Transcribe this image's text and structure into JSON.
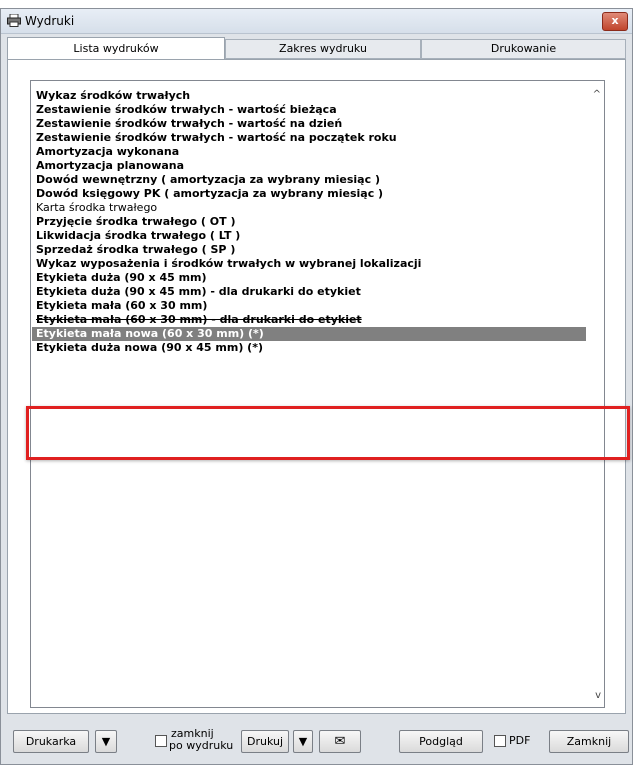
{
  "window": {
    "title": "Wydruki",
    "close_glyph": "x"
  },
  "tabs": [
    {
      "label": "Lista wydruków"
    },
    {
      "label": "Zakres wydruku"
    },
    {
      "label": "Drukowanie"
    }
  ],
  "list": {
    "items": [
      "Wykaz środków trwałych",
      "Zestawienie środków trwałych - wartość bieżąca",
      "Zestawienie środków trwałych - wartość na dzień",
      "Zestawienie środków trwałych - wartość na początek roku",
      "Amortyzacja wykonana",
      "Amortyzacja planowana",
      "Dowód wewnętrzny  ( amortyzacja za wybrany miesiąc )",
      "Dowód księgowy PK ( amortyzacja za wybrany miesiąc )",
      "Karta środka trwałego",
      "Przyjęcie środka trwałego ( OT )",
      "Likwidacja środka trwałego ( LT )",
      "Sprzedaż środka trwałego  ( SP )",
      "Wykaz wyposażenia i środków trwałych w wybranej lokalizacji",
      "Etykieta duża (90 x 45 mm)",
      "Etykieta duża (90 x 45 mm) - dla drukarki do etykiet",
      "Etykieta mała (60 x 30 mm)",
      "Etykieta mała (60 x 30 mm) - dla drukarki do etykiet",
      "Etykieta mała nowa (60 x 30 mm)  (*)",
      "Etykieta duża nowa (90 x 45 mm)  (*)"
    ]
  },
  "toolbar": {
    "printer_label": "Drukarka",
    "dropdown_glyph": "▼",
    "close_after_print_line1": "zamknij",
    "close_after_print_line2": "po wydruku",
    "print_label": "Drukuj",
    "email_glyph": "✉",
    "preview_label": "Podgląd",
    "pdf_label": "PDF",
    "close_label": "Zamknij"
  },
  "scroll": {
    "up_glyph": "^",
    "down_glyph": "v"
  }
}
